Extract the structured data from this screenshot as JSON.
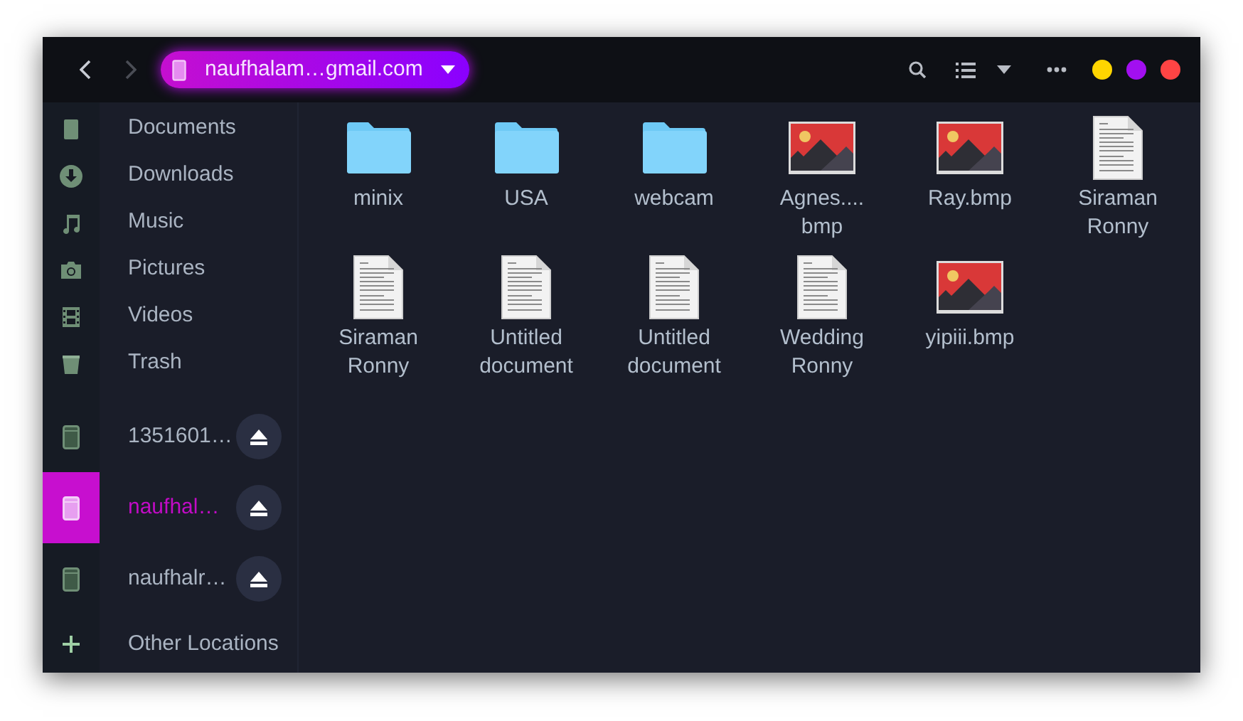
{
  "header": {
    "nav": [
      {
        "kind": "back",
        "disabled": false
      },
      {
        "kind": "forward",
        "disabled": true
      }
    ],
    "location": {
      "label": "naufhalam…gmail.com"
    },
    "window_controls": [
      {
        "color": "#ffd500"
      },
      {
        "color": "#a20ff0"
      },
      {
        "color": "#ff4444"
      }
    ]
  },
  "sidebar": {
    "places": [
      {
        "label": "Documents"
      },
      {
        "label": "Downloads"
      },
      {
        "label": "Music"
      },
      {
        "label": "Pictures"
      },
      {
        "label": "Videos"
      },
      {
        "label": "Trash"
      }
    ],
    "devices": [
      {
        "label": "1351601…",
        "selected": false
      },
      {
        "label": "naufhal…",
        "selected": true
      },
      {
        "label": "naufhalr…",
        "selected": false
      }
    ],
    "other": {
      "label": "Other Locations"
    }
  },
  "files": [
    {
      "name": "minix",
      "kind": "folder"
    },
    {
      "name": "USA",
      "kind": "folder"
    },
    {
      "name": "webcam",
      "kind": "folder"
    },
    {
      "name": "Agnes.... bmp",
      "kind": "image"
    },
    {
      "name": "Ray.bmp",
      "kind": "image"
    },
    {
      "name": "Siraman Ronny",
      "kind": "document"
    },
    {
      "name": "Siraman Ronny",
      "kind": "document"
    },
    {
      "name": "Untitled document",
      "kind": "document"
    },
    {
      "name": "Untitled document",
      "kind": "document"
    },
    {
      "name": "Wedding Ronny",
      "kind": "document"
    },
    {
      "name": "yipiii.bmp",
      "kind": "image"
    }
  ]
}
